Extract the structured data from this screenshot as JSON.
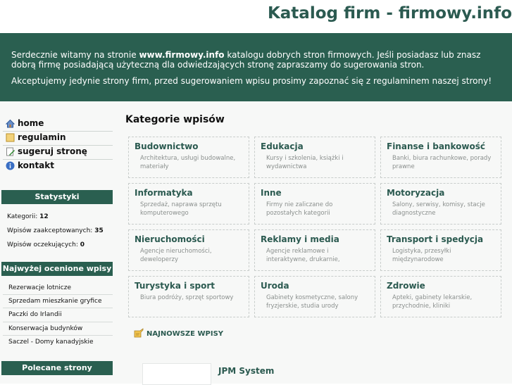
{
  "site": {
    "title": "Katalog firm - firmowy.info"
  },
  "banner": {
    "line1_pre": "Serdecznie witamy na stronie ",
    "line1_bold": "www.firmowy.info",
    "line1_post": " katalogu dobrych stron firmowych. Jeśli posiadasz lub znasz dobrą firmę posiadającą użyteczną dla odwiedzających stronę zapraszamy do sugerowania stron.",
    "line2": "Akceptujemy jedynie strony firm, przed sugerowaniem wpisu prosimy zapoznać się z regulaminem naszej strony!"
  },
  "nav": {
    "items": [
      {
        "label": "home",
        "icon": "home-icon"
      },
      {
        "label": "regulamin",
        "icon": "document-icon"
      },
      {
        "label": "sugeruj stronę",
        "icon": "edit-document-icon"
      },
      {
        "label": "kontakt",
        "icon": "info-icon"
      }
    ]
  },
  "stats": {
    "heading": "Statystyki",
    "categories_label": "Kategorii:",
    "categories_value": "12",
    "accepted_label": "Wpisów zaakceptowanych:",
    "accepted_value": "35",
    "pending_label": "Wpisów oczekujących:",
    "pending_value": "0"
  },
  "top_rated": {
    "heading": "Najwyżej ocenione wpisy",
    "items": [
      "Rezerwacje lotnicze",
      "Sprzedam mieszkanie gryfice",
      "Paczki do Irlandii",
      "Konserwacja budynków",
      "Saczel - Domy kanadyjskie"
    ]
  },
  "recommended": {
    "heading": "Polecane strony"
  },
  "content": {
    "heading": "Kategorie wpisów",
    "categories": [
      {
        "name": "Budownictwo",
        "desc": "Architektura, usługi budowalne, materiały"
      },
      {
        "name": "Edukacja",
        "desc": "Kursy i szkolenia, książki i wydawnictwa"
      },
      {
        "name": "Finanse i bankowość",
        "desc": "Banki, biura rachunkowe, porady prawne"
      },
      {
        "name": "Informatyka",
        "desc": "Sprzedaż, naprawa sprzętu komputerowego"
      },
      {
        "name": "Inne",
        "desc": "Firmy nie zaliczane do pozostałych kategorii"
      },
      {
        "name": "Motoryzacja",
        "desc": "Salony, serwisy, komisy, stacje diagnostyczne"
      },
      {
        "name": "Nieruchomości",
        "desc": "Agencje nieruchomości, deweloperzy"
      },
      {
        "name": "Reklamy i media",
        "desc": "Agencje reklamowe i interaktywne, drukarnie,"
      },
      {
        "name": "Transport i spedycja",
        "desc": "Logistyka, przesyłki międzynarodowe"
      },
      {
        "name": "Turystyka i sport",
        "desc": "Biura podróży, sprzęt sportowy"
      },
      {
        "name": "Uroda",
        "desc": "Gabinety kosmetyczne, salony fryzjerskie, studia urody"
      },
      {
        "name": "Zdrowie",
        "desc": "Apteki, gabinety lekarskie, przychodnie, kliniki"
      }
    ],
    "newest_label": "NAJNOWSZE WPISY",
    "newest_entry_title": "JPM System"
  }
}
